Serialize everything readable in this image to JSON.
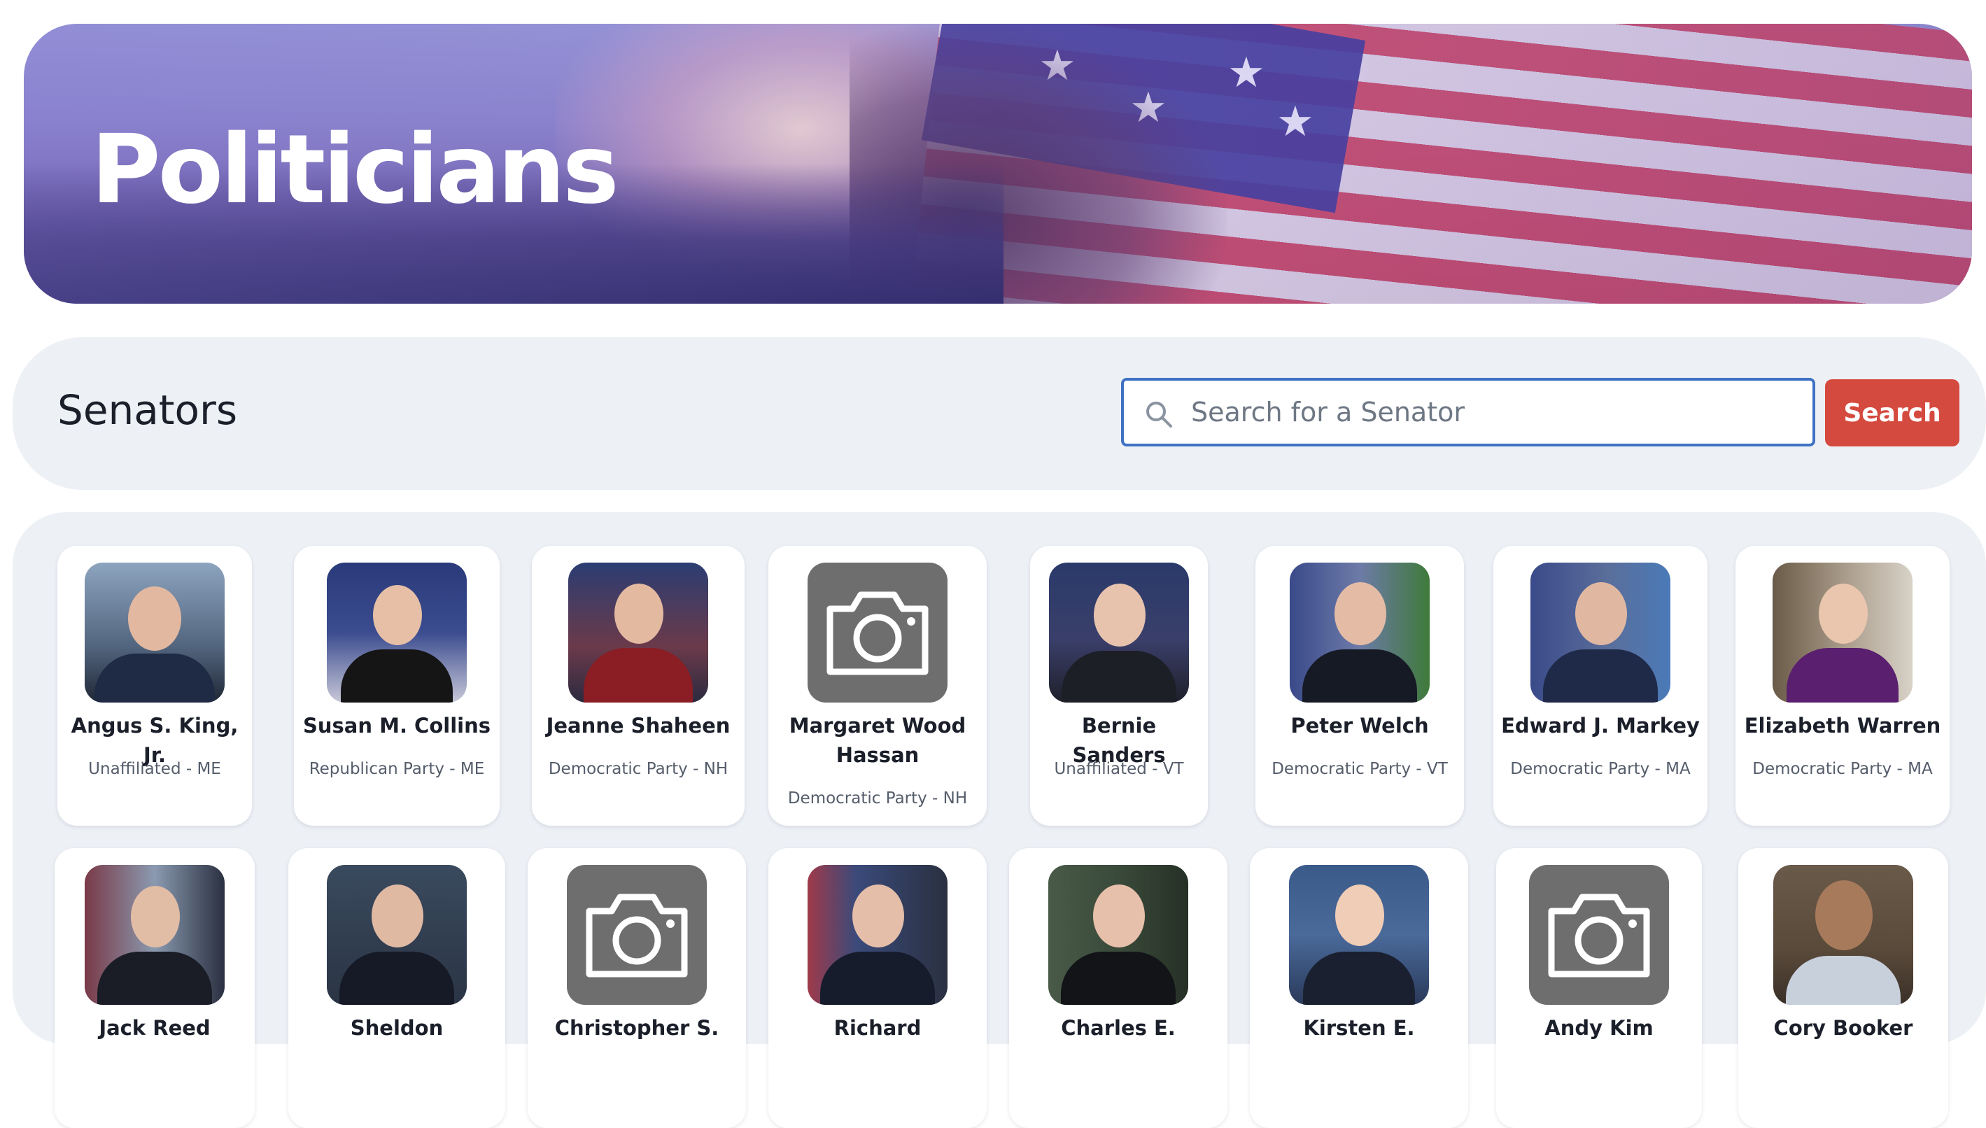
{
  "hero": {
    "title": "Politicians"
  },
  "search_bar": {
    "title": "Senators",
    "placeholder": "Search for a Senator",
    "button_label": "Search",
    "accent_color": "#d54a3f",
    "focus_color": "#3f72c4"
  },
  "senators": [
    {
      "name": "Angus S. King, Jr.",
      "subtitle": "Unaffiliated - ME",
      "photo": "portrait"
    },
    {
      "name": "Susan M. Collins",
      "subtitle": "Republican Party - ME",
      "photo": "portrait"
    },
    {
      "name": "Jeanne Shaheen",
      "subtitle": "Democratic Party - NH",
      "photo": "portrait"
    },
    {
      "name": "Margaret Wood Hassan",
      "subtitle": "Democratic Party - NH",
      "photo": "camera-placeholder"
    },
    {
      "name": "Bernie Sanders",
      "subtitle": "Unaffiliated - VT",
      "photo": "portrait"
    },
    {
      "name": "Peter Welch",
      "subtitle": "Democratic Party - VT",
      "photo": "portrait"
    },
    {
      "name": "Edward J. Markey",
      "subtitle": "Democratic Party - MA",
      "photo": "portrait"
    },
    {
      "name": "Elizabeth Warren",
      "subtitle": "Democratic Party - MA",
      "photo": "portrait"
    },
    {
      "name": "Jack Reed",
      "subtitle": "",
      "photo": "portrait"
    },
    {
      "name": "Sheldon",
      "subtitle": "",
      "photo": "portrait"
    },
    {
      "name": "Christopher S.",
      "subtitle": "",
      "photo": "camera-placeholder"
    },
    {
      "name": "Richard",
      "subtitle": "",
      "photo": "portrait"
    },
    {
      "name": "Charles E.",
      "subtitle": "",
      "photo": "portrait"
    },
    {
      "name": "Kirsten E.",
      "subtitle": "",
      "photo": "portrait"
    },
    {
      "name": "Andy Kim",
      "subtitle": "",
      "photo": "camera-placeholder"
    },
    {
      "name": "Cory Booker",
      "subtitle": "",
      "photo": "portrait"
    }
  ]
}
